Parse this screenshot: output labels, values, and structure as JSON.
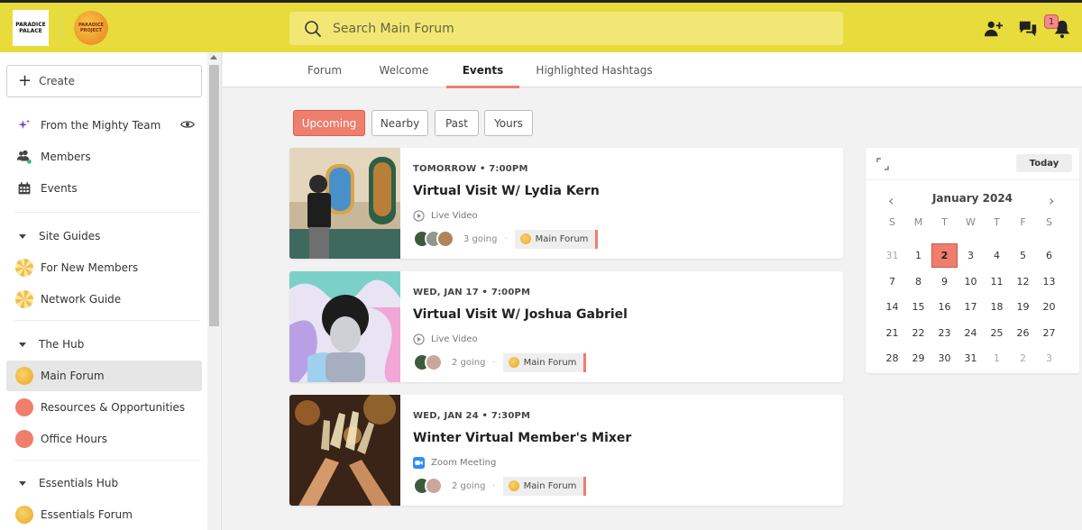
{
  "brand": {
    "logo_primary": "PARADICE PALACE",
    "logo_secondary": "PARADICE PROJECT",
    "topbar_color": "#e8dc3c",
    "accent_color": "#ef7e6c"
  },
  "search": {
    "placeholder": "Search Main Forum"
  },
  "header_icons": {
    "add_person": "add-person-icon",
    "chat": "chat-bubbles-icon",
    "notifications": "bell-icon",
    "notification_count": "1"
  },
  "sidebar": {
    "create_label": "Create",
    "items": [
      {
        "label": "From the Mighty Team",
        "icon": "sparkle-icon"
      },
      {
        "label": "Members",
        "icon": "members-icon"
      },
      {
        "label": "Events",
        "icon": "calendar-icon"
      }
    ],
    "sections": [
      {
        "label": "Site Guides",
        "items": [
          "For New Members",
          "Network Guide"
        ]
      },
      {
        "label": "The Hub",
        "items": [
          "Main Forum",
          "Resources & Opportunities",
          "Office Hours"
        ]
      },
      {
        "label": "Essentials Hub",
        "items": [
          "Essentials Forum"
        ]
      }
    ]
  },
  "tabs": [
    "Forum",
    "Welcome",
    "Events",
    "Highlighted Hashtags"
  ],
  "active_tab": "Events",
  "filters": [
    "Upcoming",
    "Nearby",
    "Past",
    "Yours"
  ],
  "active_filter": "Upcoming",
  "events": [
    {
      "when": "TOMORROW • 7:00PM",
      "title": "Virtual Visit W/ Lydia Kern",
      "type": "Live Video",
      "going": "3 going",
      "forum": "Main Forum"
    },
    {
      "when": "WED, JAN 17 • 7:00PM",
      "title": "Virtual Visit W/ Joshua Gabriel",
      "type": "Live Video",
      "going": "2 going",
      "forum": "Main Forum"
    },
    {
      "when": "WED, JAN 24 • 7:30PM",
      "title": "Winter Virtual Member's Mixer",
      "type": "Zoom Meeting",
      "going": "2 going",
      "forum": "Main Forum"
    }
  ],
  "calendar": {
    "today_label": "Today",
    "month": "January 2024",
    "weekdays": [
      "S",
      "M",
      "T",
      "W",
      "T",
      "F",
      "S"
    ],
    "weeks": [
      [
        "31",
        "1",
        "2",
        "3",
        "4",
        "5",
        "6"
      ],
      [
        "7",
        "8",
        "9",
        "10",
        "11",
        "12",
        "13"
      ],
      [
        "14",
        "15",
        "16",
        "17",
        "18",
        "19",
        "20"
      ],
      [
        "21",
        "22",
        "23",
        "24",
        "25",
        "26",
        "27"
      ],
      [
        "28",
        "29",
        "30",
        "31",
        "1",
        "2",
        "3"
      ]
    ],
    "selected": "2"
  }
}
